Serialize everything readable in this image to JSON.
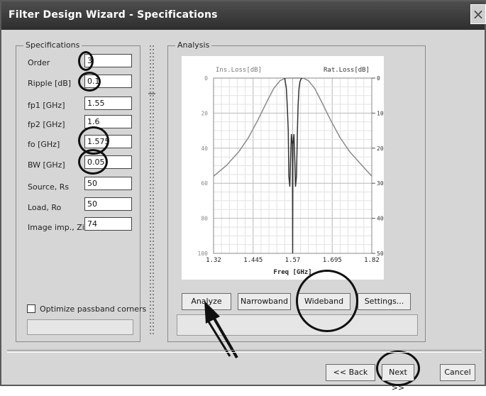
{
  "window": {
    "title": "Filter Design Wizard - Specifications",
    "close_glyph": "×"
  },
  "specs": {
    "legend": "Specifications",
    "fields": [
      {
        "label": "Order",
        "value": "3"
      },
      {
        "label": "Ripple [dB]",
        "value": "0.1"
      },
      {
        "label": "fp1 [GHz]",
        "value": "1.55"
      },
      {
        "label": "fp2 [GHz]",
        "value": "1.6"
      },
      {
        "label": "fo [GHz]",
        "value": "1.575"
      },
      {
        "label": "BW [GHz]",
        "value": "0.05"
      },
      {
        "label": "Source, Rs",
        "value": "50"
      },
      {
        "label": "Load, Ro",
        "value": "50"
      },
      {
        "label": "Image imp., Zi",
        "value": "74"
      }
    ],
    "optimize_label": "Optimize passband corners",
    "optimize_checked": false
  },
  "analysis": {
    "legend": "Analysis",
    "buttons": {
      "analyze": "Analyze",
      "narrowband": "Narrowband",
      "wideband": "Wideband",
      "settings": "Settings..."
    }
  },
  "footer": {
    "back": "<< Back",
    "next": "Next >>",
    "cancel": "Cancel"
  },
  "chart_data": {
    "type": "line",
    "xlabel": "Freq [GHz]",
    "left_axis_label": "Ins.Loss[dB]",
    "right_axis_label": "Rat.Loss[dB]",
    "x_ticks": [
      "1.32",
      "1.445",
      "1.57",
      "1.695",
      "1.82"
    ],
    "xlim": [
      1.32,
      1.82
    ],
    "left_ticks": [
      "0",
      "20",
      "40",
      "60",
      "80",
      "100"
    ],
    "left_ylim": [
      0,
      100
    ],
    "right_ticks": [
      "0",
      "10",
      "20",
      "30",
      "40",
      "50"
    ],
    "right_ylim": [
      0,
      50
    ],
    "grid": true,
    "series": [
      {
        "axis": "left",
        "x": [
          1.32,
          1.36,
          1.4,
          1.43,
          1.46,
          1.49,
          1.51,
          1.53,
          1.545,
          1.55,
          1.555,
          1.56,
          1.565,
          1.57,
          1.575,
          1.58,
          1.585,
          1.59,
          1.595,
          1.6,
          1.605,
          1.62,
          1.64,
          1.66,
          1.69,
          1.72,
          1.75,
          1.79,
          1.82
        ],
        "y": [
          56,
          50,
          42,
          34,
          24,
          13,
          6,
          1.5,
          0.2,
          0.1,
          0.05,
          0,
          0,
          0,
          0,
          0,
          0,
          0,
          0.05,
          0.1,
          0.2,
          1.5,
          6,
          13,
          24,
          34,
          42,
          50,
          56
        ]
      },
      {
        "axis": "right",
        "x": [
          1.545,
          1.55,
          1.553,
          1.556,
          1.558,
          1.561,
          1.563,
          1.566,
          1.569,
          1.57,
          1.571,
          1.574,
          1.577,
          1.579,
          1.582,
          1.585,
          1.587,
          1.59,
          1.593,
          1.597,
          1.6
        ],
        "y": [
          0,
          3,
          8,
          15,
          28,
          31,
          24,
          16,
          19,
          50,
          19,
          16,
          24,
          31,
          28,
          15,
          8,
          3,
          1,
          0.2,
          0
        ]
      }
    ]
  }
}
